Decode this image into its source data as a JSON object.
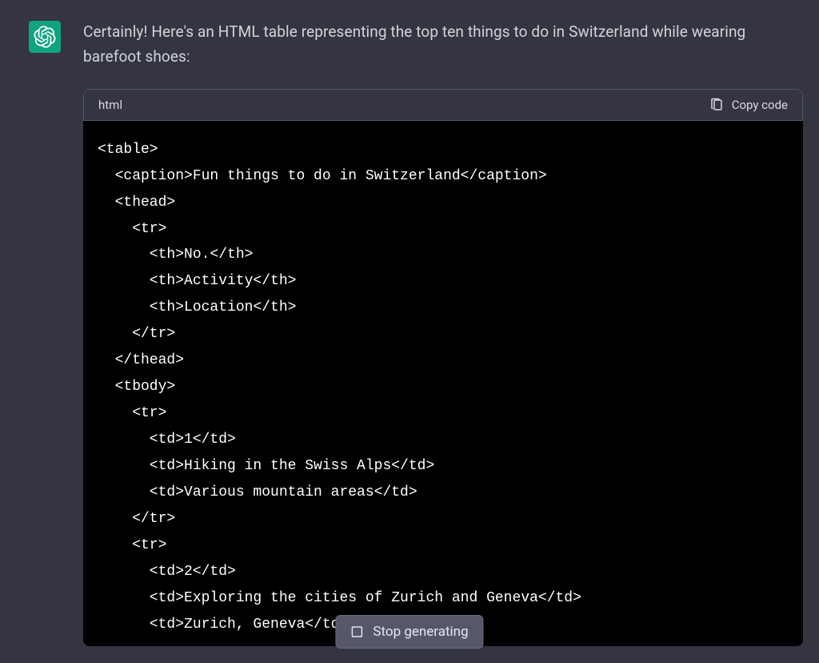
{
  "message": {
    "intro": "Certainly! Here's an HTML table representing the top ten things to do in Switzerland while wearing barefoot shoes:"
  },
  "codeblock": {
    "language": "html",
    "copy_label": "Copy code",
    "code": "<table>\n  <caption>Fun things to do in Switzerland</caption>\n  <thead>\n    <tr>\n      <th>No.</th>\n      <th>Activity</th>\n      <th>Location</th>\n    </tr>\n  </thead>\n  <tbody>\n    <tr>\n      <td>1</td>\n      <td>Hiking in the Swiss Alps</td>\n      <td>Various mountain areas</td>\n    </tr>\n    <tr>\n      <td>2</td>\n      <td>Exploring the cities of Zurich and Geneva</td>\n      <td>Zurich, Geneva</td>"
  },
  "controls": {
    "stop_label": "Stop generating"
  }
}
